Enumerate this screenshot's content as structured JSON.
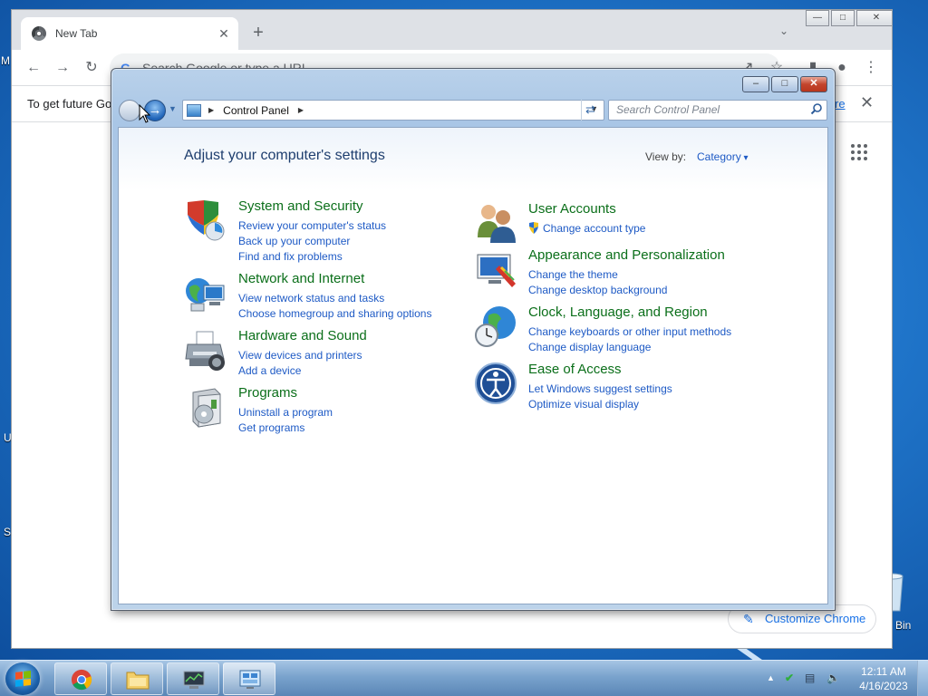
{
  "desktop": {
    "edge_texts": [
      "M",
      "U",
      "S",
      "Bin"
    ]
  },
  "chrome": {
    "tab_title": "New Tab",
    "tab_close": "✕",
    "new_tab": "+",
    "tab_search": "⌄",
    "omnibox_placeholder": "Search Google or type a URL",
    "infobar_text": "To get future Go",
    "infobar_link": "re",
    "infobar_close": "✕",
    "customize_label": "Customize Chrome"
  },
  "control_panel": {
    "address": {
      "crumb": "Control Panel"
    },
    "search_placeholder": "Search Control Panel",
    "heading": "Adjust your computer's settings",
    "view_by_label": "View by:",
    "view_by_value": "Category",
    "left_categories": [
      {
        "title": "System and Security",
        "icon": "shield-icon",
        "links": [
          "Review your computer's status",
          "Back up your computer",
          "Find and fix problems"
        ]
      },
      {
        "title": "Network and Internet",
        "icon": "network-icon",
        "links": [
          "View network status and tasks",
          "Choose homegroup and sharing options"
        ]
      },
      {
        "title": "Hardware and Sound",
        "icon": "printer-icon",
        "links": [
          "View devices and printers",
          "Add a device"
        ]
      },
      {
        "title": "Programs",
        "icon": "programs-icon",
        "links": [
          "Uninstall a program",
          "Get programs"
        ]
      }
    ],
    "right_categories": [
      {
        "title": "User Accounts",
        "icon": "users-icon",
        "links": [
          "Change account type"
        ]
      },
      {
        "title": "Appearance and Personalization",
        "icon": "appearance-icon",
        "links": [
          "Change the theme",
          "Change desktop background"
        ]
      },
      {
        "title": "Clock, Language, and Region",
        "icon": "globe-clock-icon",
        "links": [
          "Change keyboards or other input methods",
          "Change display language"
        ]
      },
      {
        "title": "Ease of Access",
        "icon": "ease-of-access-icon",
        "links": [
          "Let Windows suggest settings",
          "Optimize visual display"
        ]
      }
    ]
  },
  "taskbar": {
    "time": "12:11 AM",
    "date": "4/16/2023"
  }
}
